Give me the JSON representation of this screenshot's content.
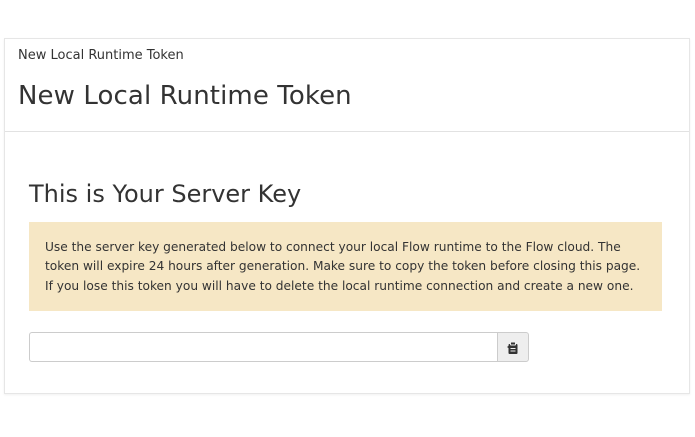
{
  "header": {
    "breadcrumb": "New Local Runtime Token",
    "title": "New Local Runtime Token"
  },
  "main": {
    "section_title": "This is Your Server Key",
    "notice": {
      "line1": "Use the server key generated below to connect your local Flow runtime to the Flow cloud. The",
      "line2": "token will expire 24 hours after generation. Make sure to copy the token before closing this page.",
      "line3": "If you lose this token you will have to delete the local runtime connection and create a new one."
    },
    "server_key": {
      "value": "",
      "copy_icon": "clipboard-copy-icon"
    }
  },
  "colors": {
    "notice_background": "#f6e7c5",
    "text": "#333333",
    "divider": "#e2e2e2"
  }
}
